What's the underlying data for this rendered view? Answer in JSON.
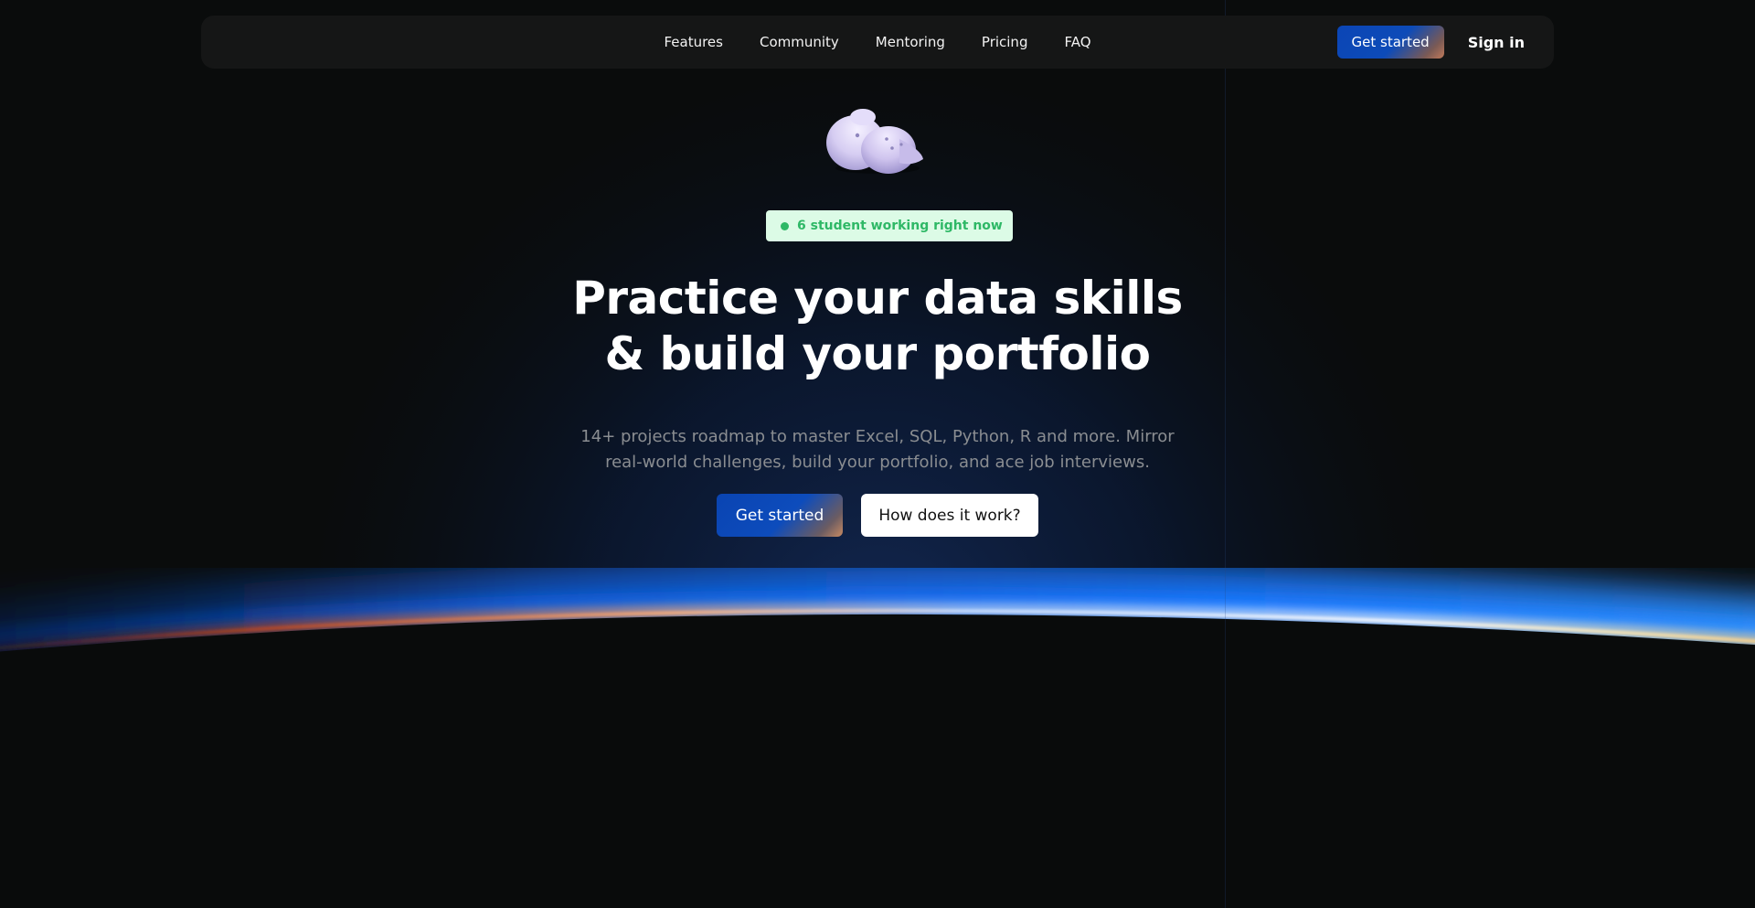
{
  "nav": {
    "links": [
      "Features",
      "Community",
      "Mentoring",
      "Pricing",
      "FAQ"
    ],
    "get_started_label": "Get started",
    "sign_in_label": "Sign in"
  },
  "hero": {
    "live_badge": "6 student working right now",
    "title_line_1": "Practice your data skills",
    "title_line_2": "& build your portfolio",
    "subtitle_line_1": "14+ projects roadmap to master Excel, SQL, Python, R and more. Mirror",
    "subtitle_line_2": "real-world challenges, build your portfolio, and ace job interviews.",
    "primary_cta": "Get started",
    "secondary_cta": "How does it work?"
  },
  "colors": {
    "background": "#0a0c0c",
    "nav_background": "#151616",
    "accent_blue": "#0b45b5",
    "badge_background": "#dcfbe6",
    "badge_text": "#2eb866",
    "subtitle_text": "#8a8d91"
  },
  "icons": {
    "mascot": "cloud-mascot-icon",
    "live_indicator": "live-dot-icon"
  }
}
